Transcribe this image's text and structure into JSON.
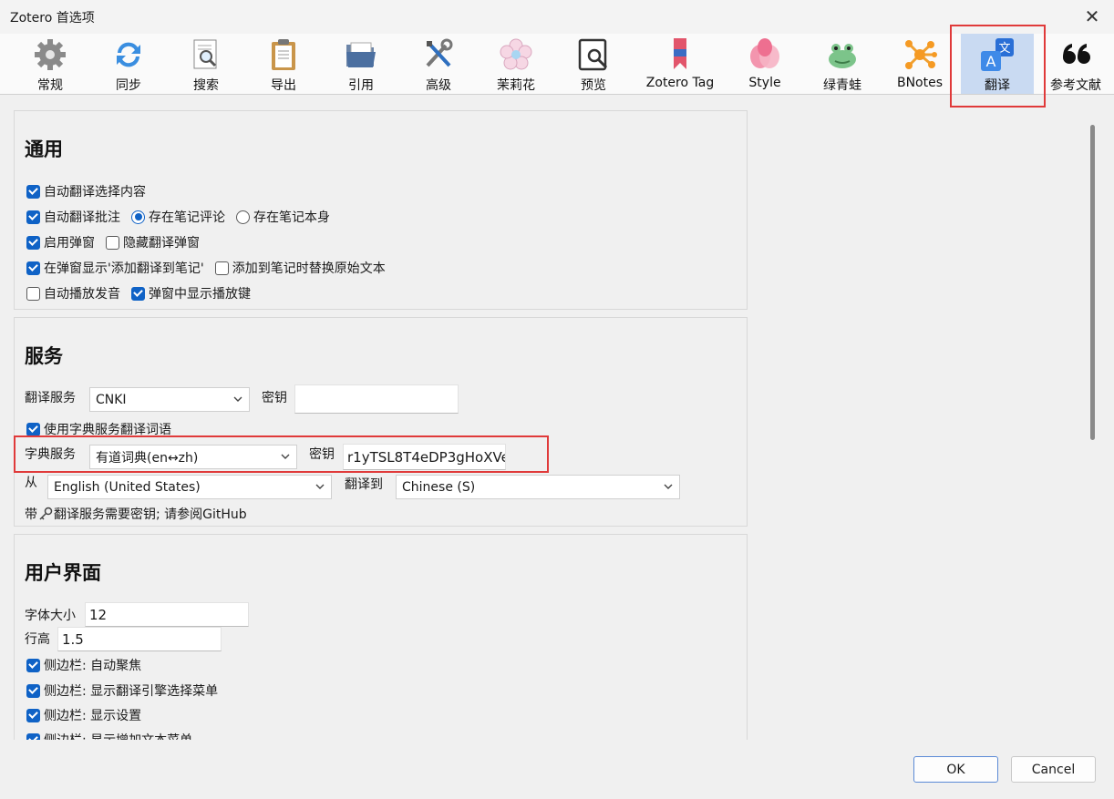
{
  "window": {
    "title": "Zotero 首选项",
    "close": "✕"
  },
  "toolbar": {
    "items": [
      {
        "label": "常规",
        "icon": "gear-icon"
      },
      {
        "label": "同步",
        "icon": "sync-icon"
      },
      {
        "label": "搜索",
        "icon": "search-doc-icon"
      },
      {
        "label": "导出",
        "icon": "clipboard-icon"
      },
      {
        "label": "引用",
        "icon": "folder-icon"
      },
      {
        "label": "高级",
        "icon": "tools-icon"
      },
      {
        "label": "茉莉花",
        "icon": "jasmine-icon"
      },
      {
        "label": "预览",
        "icon": "preview-icon"
      },
      {
        "label": "Zotero Tag",
        "icon": "bookmark-icon"
      },
      {
        "label": "Style",
        "icon": "style-icon"
      },
      {
        "label": "绿青蛙",
        "icon": "frog-icon"
      },
      {
        "label": "BNotes",
        "icon": "molecule-icon"
      },
      {
        "label": "翻译",
        "icon": "translate-icon",
        "selected": true
      },
      {
        "label": "参考文献",
        "icon": "quote-icon"
      }
    ]
  },
  "general": {
    "heading": "通用",
    "auto_translate_selection": "自动翻译选择内容",
    "auto_translate_annotation": "自动翻译批注",
    "save_in_note_comment": "存在笔记评论",
    "save_in_note_body": "存在笔记本身",
    "enable_popup": "启用弹窗",
    "hide_popup": "隐藏翻译弹窗",
    "show_add_to_note": "在弹窗显示'添加翻译到笔记'",
    "replace_original": "添加到笔记时替换原始文本",
    "auto_play": "自动播放发音",
    "show_play_button": "弹窗中显示播放键"
  },
  "service": {
    "heading": "服务",
    "translate_service_label": "翻译服务",
    "translate_service_value": "CNKI",
    "key_label": "密钥",
    "key_value": "",
    "use_dict": "使用字典服务翻译词语",
    "dict_service_label": "字典服务",
    "dict_service_value": "有道词典(en↔zh)",
    "dict_key_label": "密钥",
    "dict_key_value": "r1yTSL8T4eDP3gHoXVe",
    "from_label": "从",
    "from_value": "English (United States)",
    "to_label": "翻译到",
    "to_value": "Chinese (S)",
    "note_prefix": "带",
    "note_text": "翻译服务需要密钥; 请参阅GitHub"
  },
  "ui": {
    "heading": "用户界面",
    "font_size_label": "字体大小",
    "font_size_value": "12",
    "line_height_label": "行高",
    "line_height_value": "1.5",
    "sidebar_autofocus": "侧边栏: 自动聚焦",
    "sidebar_engine_menu": "侧边栏: 显示翻译引擎选择菜单",
    "sidebar_settings": "侧边栏: 显示设置",
    "sidebar_more": "侧边栏: 显示增加文本菜单"
  },
  "footer": {
    "ok": "OK",
    "cancel": "Cancel"
  },
  "colors": {
    "accent": "#0f62c6",
    "highlight": "#e03a3a",
    "selected_tab": "#c9daf2"
  }
}
